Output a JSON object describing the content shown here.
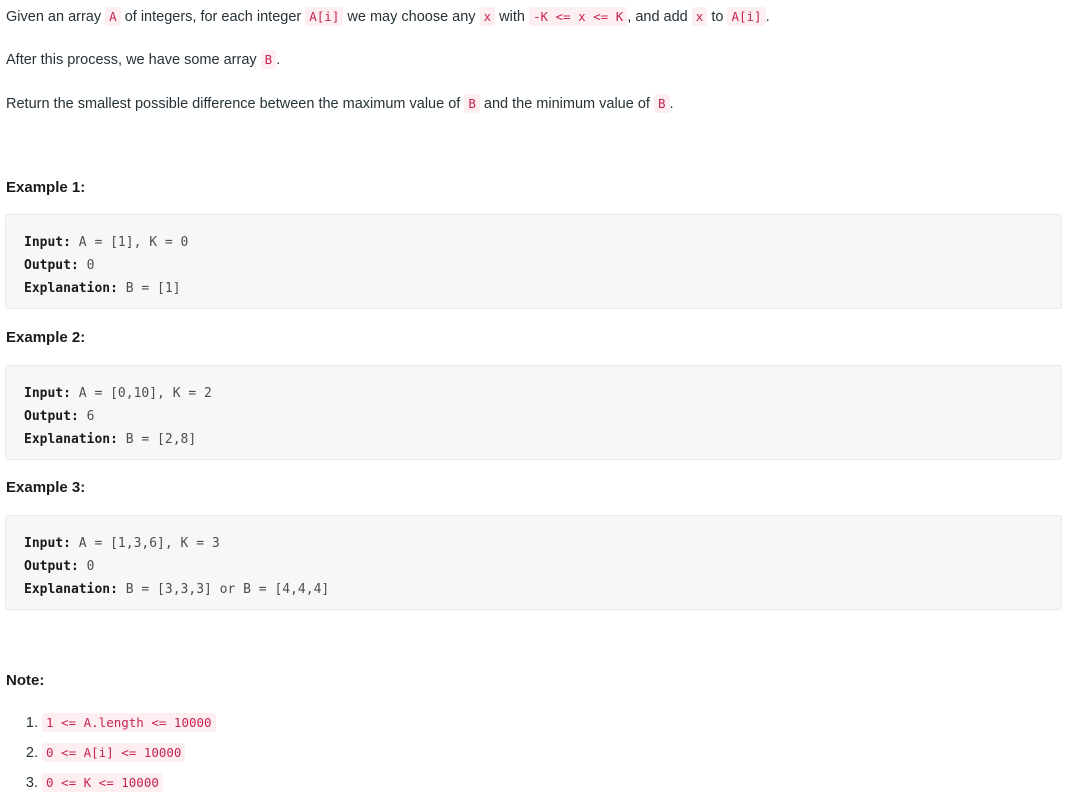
{
  "description": {
    "paragraph1": [
      {
        "type": "text",
        "value": "Given an array "
      },
      {
        "type": "code",
        "value": "A"
      },
      {
        "type": "text",
        "value": " of integers, for each integer "
      },
      {
        "type": "code",
        "value": "A[i]"
      },
      {
        "type": "text",
        "value": " we may choose any "
      },
      {
        "type": "code",
        "value": "x"
      },
      {
        "type": "text",
        "value": " with "
      },
      {
        "type": "code",
        "value": "-K <= x <= K"
      },
      {
        "type": "text",
        "value": ", and add "
      },
      {
        "type": "code",
        "value": "x"
      },
      {
        "type": "text",
        "value": " to "
      },
      {
        "type": "code",
        "value": "A[i]"
      },
      {
        "type": "text",
        "value": "."
      }
    ],
    "paragraph2": [
      {
        "type": "text",
        "value": "After this process, we have some array "
      },
      {
        "type": "code",
        "value": "B"
      },
      {
        "type": "text",
        "value": "."
      }
    ],
    "paragraph3": [
      {
        "type": "text",
        "value": "Return the smallest possible difference between the maximum value of "
      },
      {
        "type": "code",
        "value": "B"
      },
      {
        "type": "text",
        "value": " and the minimum value of "
      },
      {
        "type": "code",
        "value": "B"
      },
      {
        "type": "text",
        "value": "."
      }
    ]
  },
  "examples": [
    {
      "title": "Example 1:",
      "input_label": "Input:",
      "input_value": " A = [1], K = 0",
      "output_label": "Output:",
      "output_value": " 0",
      "explanation_label": "Explanation:",
      "explanation_value": " B = [1]"
    },
    {
      "title": "Example 2:",
      "input_label": "Input:",
      "input_value": " A = [0,10], K = 2",
      "output_label": "Output:",
      "output_value": " 6",
      "explanation_label": "Explanation:",
      "explanation_value": " B = [2,8]"
    },
    {
      "title": "Example 3:",
      "input_label": "Input:",
      "input_value": " A = [1,3,6], K = 3",
      "output_label": "Output:",
      "output_value": " 0",
      "explanation_label": "Explanation:",
      "explanation_value": " B = [3,3,3] or B = [4,4,4]"
    }
  ],
  "note": {
    "title": "Note:",
    "items": [
      "1 <= A.length <= 10000",
      "0 <= A[i] <= 10000",
      "0 <= K <= 10000"
    ]
  },
  "colors": {
    "inline_code_text": "#c7254e",
    "inline_code_background": "#fdeef2",
    "code_block_background": "#f7f7f7",
    "code_block_border": "#eaeaea",
    "body_text": "#263238",
    "heading_text": "#1a1a1a"
  }
}
